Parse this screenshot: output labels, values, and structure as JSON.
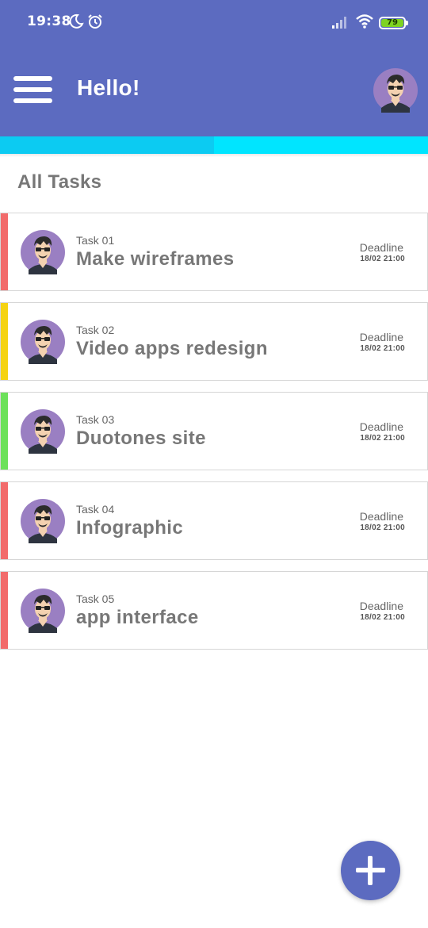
{
  "status_bar": {
    "time": "19:38",
    "battery_level": "79",
    "icons": [
      "moon-icon",
      "alarm-icon",
      "signal-icon",
      "wifi-icon",
      "battery-icon"
    ]
  },
  "header": {
    "greeting": "Hello!",
    "menu_icon": "hamburger-menu-icon",
    "avatar": "user-avatar"
  },
  "progress": {
    "fraction": 0.5
  },
  "section": {
    "title": "All Tasks"
  },
  "tasks": [
    {
      "number": "Task 01",
      "title": "Make wireframes",
      "deadline_label": "Deadline",
      "deadline": "18/02 21:00",
      "color": "#f26b6b"
    },
    {
      "number": "Task 02",
      "title": "Video apps redesign",
      "deadline_label": "Deadline",
      "deadline": "18/02 21:00",
      "color": "#f5d312"
    },
    {
      "number": "Task 03",
      "title": "Duotones site",
      "deadline_label": "Deadline",
      "deadline": "18/02 21:00",
      "color": "#6ce15a"
    },
    {
      "number": "Task 04",
      "title": "Infographic",
      "deadline_label": "Deadline",
      "deadline": "18/02 21:00",
      "color": "#f26b6b"
    },
    {
      "number": "Task 05",
      "title": "app interface",
      "deadline_label": "Deadline",
      "deadline": "18/02 21:00",
      "color": "#f26b6b"
    }
  ],
  "fab": {
    "icon": "plus-icon"
  },
  "colors": {
    "primary": "#5c6bc0",
    "progress_track": "#00e5ff",
    "progress_fill": "#0ccbf2"
  }
}
